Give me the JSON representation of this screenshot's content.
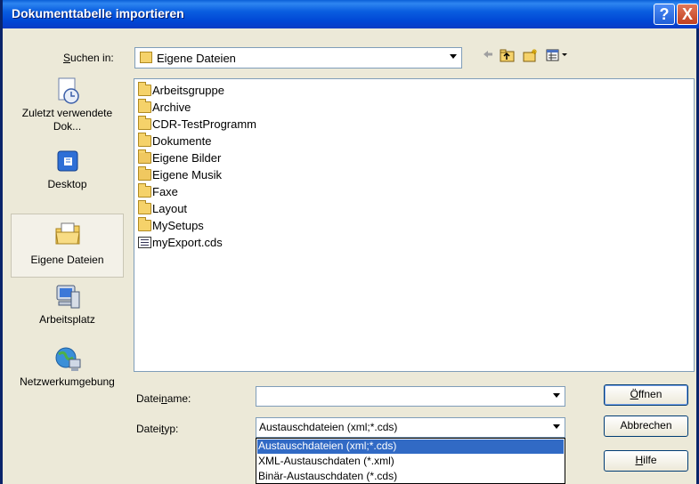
{
  "window": {
    "title": "Dokumenttabelle importieren"
  },
  "titlebar": {
    "help_glyph": "?",
    "close_glyph": "X"
  },
  "lookin": {
    "label_u": "S",
    "label_rest": "uchen in:",
    "value": "Eigene Dateien"
  },
  "places": [
    {
      "label": "Zuletzt verwendete Dok...",
      "icon": "recent-documents-icon",
      "selected": false
    },
    {
      "label": "Desktop",
      "icon": "desktop-icon",
      "selected": false
    },
    {
      "label": "Eigene Dateien",
      "icon": "my-documents-icon",
      "selected": true
    },
    {
      "label": "Arbeitsplatz",
      "icon": "my-computer-icon",
      "selected": false
    },
    {
      "label": "Netzwerkumgebung",
      "icon": "network-icon",
      "selected": false
    }
  ],
  "files": [
    {
      "name": "Arbeitsgruppe",
      "type": "folder"
    },
    {
      "name": "Archive",
      "type": "folder"
    },
    {
      "name": "CDR-TestProgramm",
      "type": "folder"
    },
    {
      "name": "Dokumente",
      "type": "folder"
    },
    {
      "name": "Eigene Bilder",
      "type": "special-folder"
    },
    {
      "name": "Eigene Musik",
      "type": "special-folder"
    },
    {
      "name": "Faxe",
      "type": "folder"
    },
    {
      "name": "Layout",
      "type": "folder"
    },
    {
      "name": "MySetups",
      "type": "folder"
    },
    {
      "name": "myExport.cds",
      "type": "file"
    }
  ],
  "filename": {
    "label_a": "Datei",
    "label_u": "n",
    "label_b": "ame:",
    "value": ""
  },
  "filetype": {
    "label_a": "Datei",
    "label_u": "t",
    "label_b": "yp:",
    "value": "Austauschdateien (xml;*.cds)",
    "options": [
      "Austauschdateien (xml;*.cds)",
      "XML-Austauschdaten (*.xml)",
      "Binär-Austauschdaten (*.cds)"
    ]
  },
  "buttons": {
    "open_u": "Ö",
    "open_rest": "ffnen",
    "cancel": "Abbrechen",
    "help_u": "H",
    "help_rest": "ilfe"
  },
  "colors": {
    "titlebar": "#0046d5",
    "selection": "#316ac5",
    "dialog_bg": "#ece9d8"
  }
}
